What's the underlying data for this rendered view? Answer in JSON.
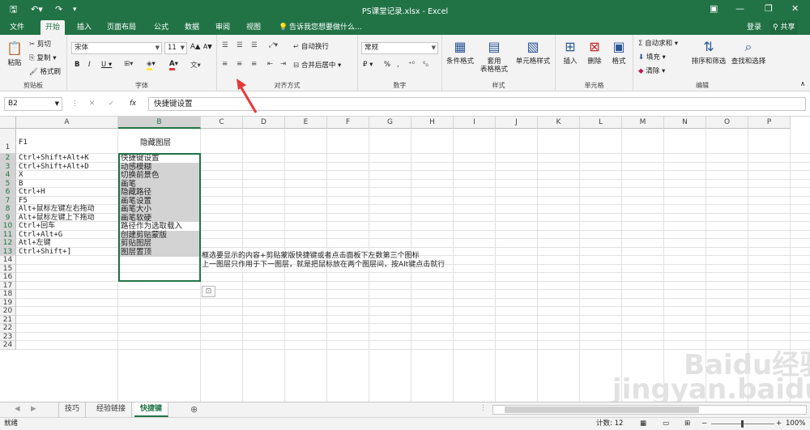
{
  "window": {
    "title": "PS课堂记录.xlsx - Excel",
    "save_icon": "save-icon",
    "undo_icon": "undo-icon",
    "redo_icon": "redo-icon",
    "buttons": [
      "▣",
      "—",
      "❐",
      "✕"
    ]
  },
  "tabs": {
    "items": [
      "文件",
      "开始",
      "插入",
      "页面布局",
      "公式",
      "数据",
      "审阅",
      "视图"
    ],
    "active": "开始",
    "tell_me": "告诉我您想要做什么...",
    "login": "登录",
    "share": "共享"
  },
  "ribbon": {
    "clipboard": {
      "label": "剪贴板",
      "paste": "粘贴",
      "cut": "剪切",
      "copy": "复制 ▾",
      "format_painter": "格式刷"
    },
    "font": {
      "label": "字体",
      "font_name": "宋体",
      "font_size": "11",
      "bold": "B",
      "italic": "I",
      "underline": "U ▾",
      "grow": "A▲",
      "shrink": "A▼",
      "font_color": "A"
    },
    "alignment": {
      "label": "对齐方式",
      "wrap": "自动换行",
      "merge": "合并后居中 ▾"
    },
    "number": {
      "label": "数字",
      "format": "常规",
      "currency": "₽ ▾",
      "percent": "%",
      "comma": ","
    },
    "styles": {
      "label": "样式",
      "conditional": "条件格式",
      "table": "套用\n表格格式",
      "cell_styles": "单元格样式"
    },
    "cells": {
      "label": "单元格",
      "insert": "插入",
      "delete": "删除",
      "format": "格式"
    },
    "editing": {
      "label": "编辑",
      "autosum": "自动求和 ▾",
      "fill": "填充 ▾",
      "clear": "清除 ▾",
      "sort": "排序和筛选",
      "find": "查找和选择"
    }
  },
  "formula_bar": {
    "name_box": "B2",
    "fx": "fx",
    "content": "快捷键设置"
  },
  "columns": [
    "A",
    "B",
    "C",
    "D",
    "E",
    "F",
    "G",
    "H",
    "I",
    "J",
    "K",
    "L",
    "M",
    "N",
    "O",
    "P"
  ],
  "rows": [
    "1",
    "2",
    "3",
    "4",
    "5",
    "6",
    "7",
    "8",
    "9",
    "10",
    "11",
    "12",
    "13",
    "14",
    "15",
    "16",
    "17",
    "18",
    "19",
    "20",
    "21",
    "22",
    "23",
    "24"
  ],
  "cells": {
    "A1": "F1",
    "B1": "隐藏图层",
    "A": [
      "Ctrl+Shift+Alt+K",
      "Ctrl+Shift+Alt+D",
      "X",
      "B",
      "Ctrl+H",
      "F5",
      "Alt+鼠标左键左右拖动",
      "Alt+鼠标左键上下拖动",
      "Ctrl+回车",
      "Ctrl+Alt+G",
      "Atl+左键",
      "Ctrl+Shift+]"
    ],
    "B": [
      "快捷键设置",
      "动感模糊",
      "切换前景色",
      "画笔",
      "隐藏路径",
      "画笔设置",
      "画笔大小",
      "画笔软硬",
      "路径作为选取载入",
      "创建剪贴蒙版",
      "剪贴图层",
      "图层置顶"
    ],
    "C11": "框选要显示的内容+剪贴蒙版快捷键或者点击面板下左数第三个图标",
    "C12": "上一图层只作用于下一图层，就是把鼠标放在两个图层间，按Alt键点击就行"
  },
  "sheets": {
    "tabs": [
      "技巧",
      "经验链接",
      "快捷键"
    ],
    "active": "快捷键",
    "add": "⊕"
  },
  "status": {
    "ready": "就绪",
    "count": "计数: 12",
    "zoom": "100%"
  },
  "watermark": "Baidu经验\njingyan.baidu.com"
}
